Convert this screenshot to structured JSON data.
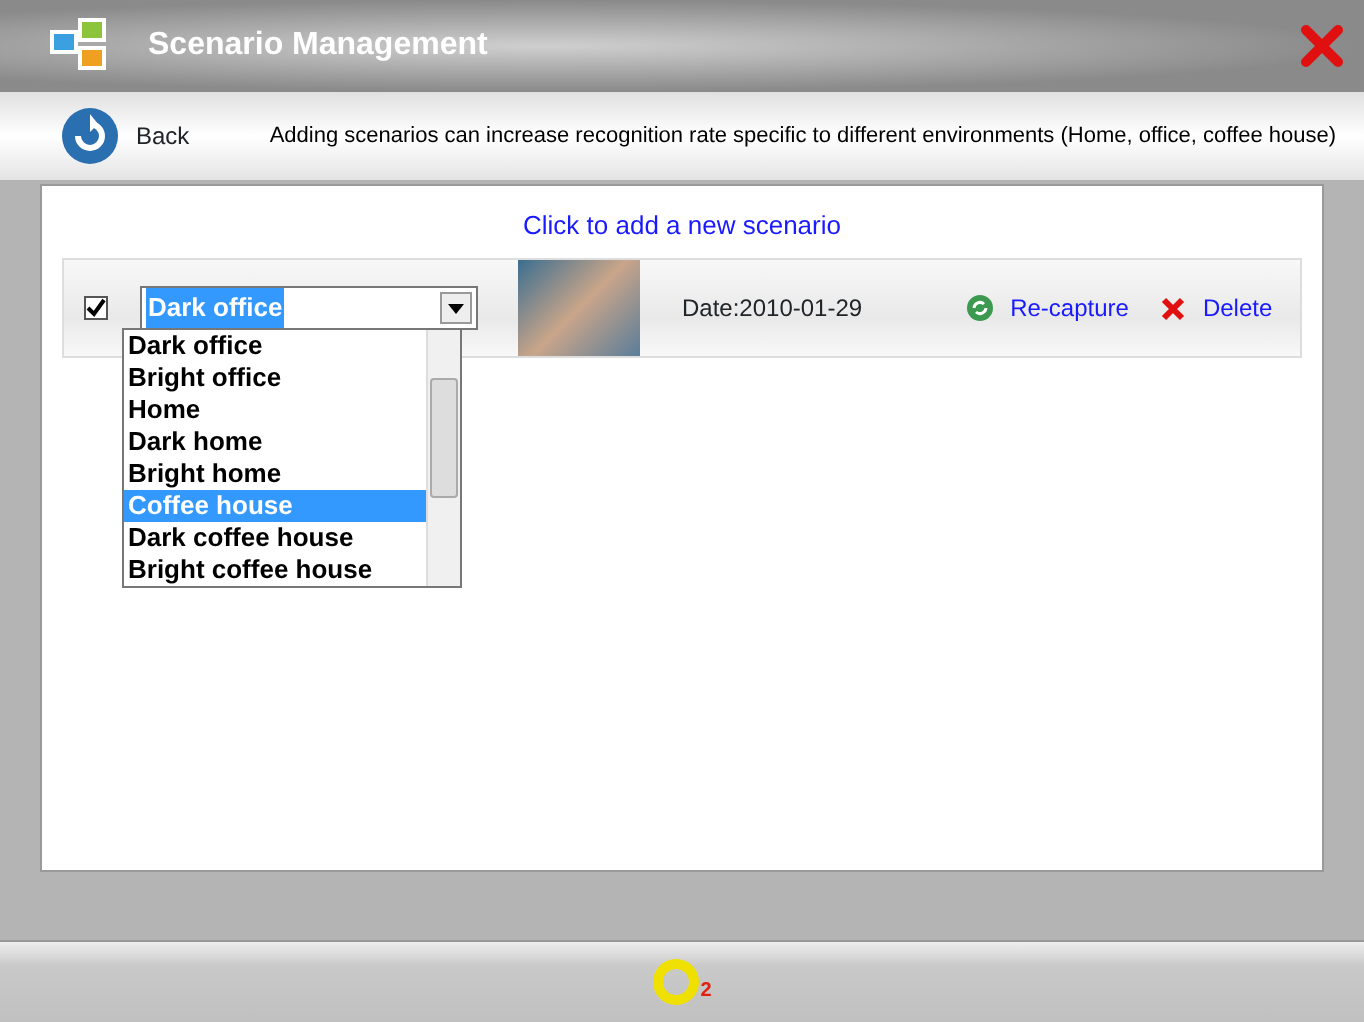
{
  "window": {
    "title": "Scenario Management"
  },
  "toolbar": {
    "back_label": "Back",
    "hint": "Adding scenarios can increase recognition rate specific to different environments (Home, office, coffee house)"
  },
  "add_link": "Click to add a new scenario",
  "scenarios": [
    {
      "checked": true,
      "scenario": "Dark office",
      "date": "Date:2010-01-29",
      "actions": [
        {
          "kind": "recapture",
          "label": "Re-capture"
        },
        {
          "kind": "delete",
          "label": "Delete"
        }
      ]
    }
  ],
  "dropdown_list": {
    "items": [
      {
        "label": "Dark office",
        "selected": false
      },
      {
        "label": "Bright office",
        "selected": false
      },
      {
        "label": "Home",
        "selected": false
      },
      {
        "label": "Dark home",
        "selected": false
      },
      {
        "label": "Bright home",
        "selected": false
      },
      {
        "label": "Coffee house",
        "selected": true
      },
      {
        "label": "Dark coffee house",
        "selected": false
      },
      {
        "label": "Bright coffee house",
        "selected": false
      }
    ]
  },
  "footer": {
    "logo_superscript": "2"
  }
}
